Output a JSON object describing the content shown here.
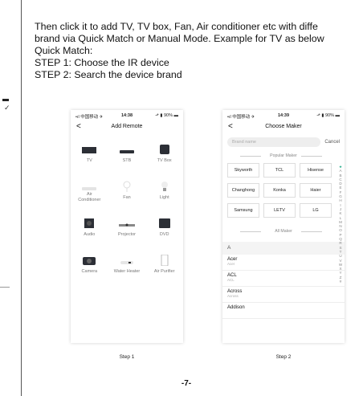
{
  "intro": {
    "line1": "Then click it to add TV, TV box, Fan, Air conditioner etc with diffe",
    "line2": "brand via Quick Match or Manual Mode. Example for TV as below",
    "line3": "Quick Match:",
    "line4": "STEP 1:  Choose the IR device",
    "line5": "STEP 2:  Search the device brand"
  },
  "phone1": {
    "status_left": "•ıl 中国移动 ✈",
    "status_time": "14:38",
    "status_right": "⬏ ▮ 90% ▬",
    "back": "<",
    "title": "Add Remote",
    "devices": [
      {
        "icon": "tv-icon",
        "label": "TV"
      },
      {
        "icon": "stb-icon",
        "label": "STB"
      },
      {
        "icon": "tv-box-icon",
        "label": "TV Box"
      },
      {
        "icon": "air-conditioner-icon",
        "label": "Air\nConditioner"
      },
      {
        "icon": "fan-icon",
        "label": "Fan"
      },
      {
        "icon": "light-icon",
        "label": "Light"
      },
      {
        "icon": "audio-icon",
        "label": "Audio"
      },
      {
        "icon": "projector-icon",
        "label": "Projector"
      },
      {
        "icon": "dvd-icon",
        "label": "DVD"
      },
      {
        "icon": "camera-icon",
        "label": "Camera"
      },
      {
        "icon": "water-heater-icon",
        "label": "Water Heater"
      },
      {
        "icon": "air-purifier-icon",
        "label": "Air Purifier"
      }
    ]
  },
  "phone2": {
    "status_left": "•ıl 中国移动 ✈",
    "status_time": "14:39",
    "status_right": "⬏ ▮ 90% ▬",
    "back": "<",
    "title": "Choose Maker",
    "search_placeholder": "Brand name",
    "cancel": "Cancel",
    "popular_label": "Popular Maker",
    "popular": [
      "Skyworth",
      "TCL",
      "Hisense",
      "Changhong",
      "Konka",
      "Haier",
      "Samsung",
      "LETV",
      "LG"
    ],
    "all_label": "All Maker",
    "letter": "A",
    "makers": [
      {
        "name": "Acer",
        "sub": "Acer"
      },
      {
        "name": "ACL",
        "sub": "ACL"
      },
      {
        "name": "Across",
        "sub": "Across"
      },
      {
        "name": "Addison",
        "sub": ""
      }
    ],
    "alphabet": [
      "★",
      "A",
      "B",
      "C",
      "D",
      "E",
      "F",
      "G",
      "H",
      "I",
      "J",
      "K",
      "L",
      "M",
      "N",
      "O",
      "P",
      "Q",
      "R",
      "S",
      "T",
      "U",
      "V",
      "W",
      "X",
      "Y",
      "Z",
      "#"
    ]
  },
  "captions": {
    "step1": "Step 1",
    "step2": "Step 2"
  },
  "page_number": "-7-"
}
